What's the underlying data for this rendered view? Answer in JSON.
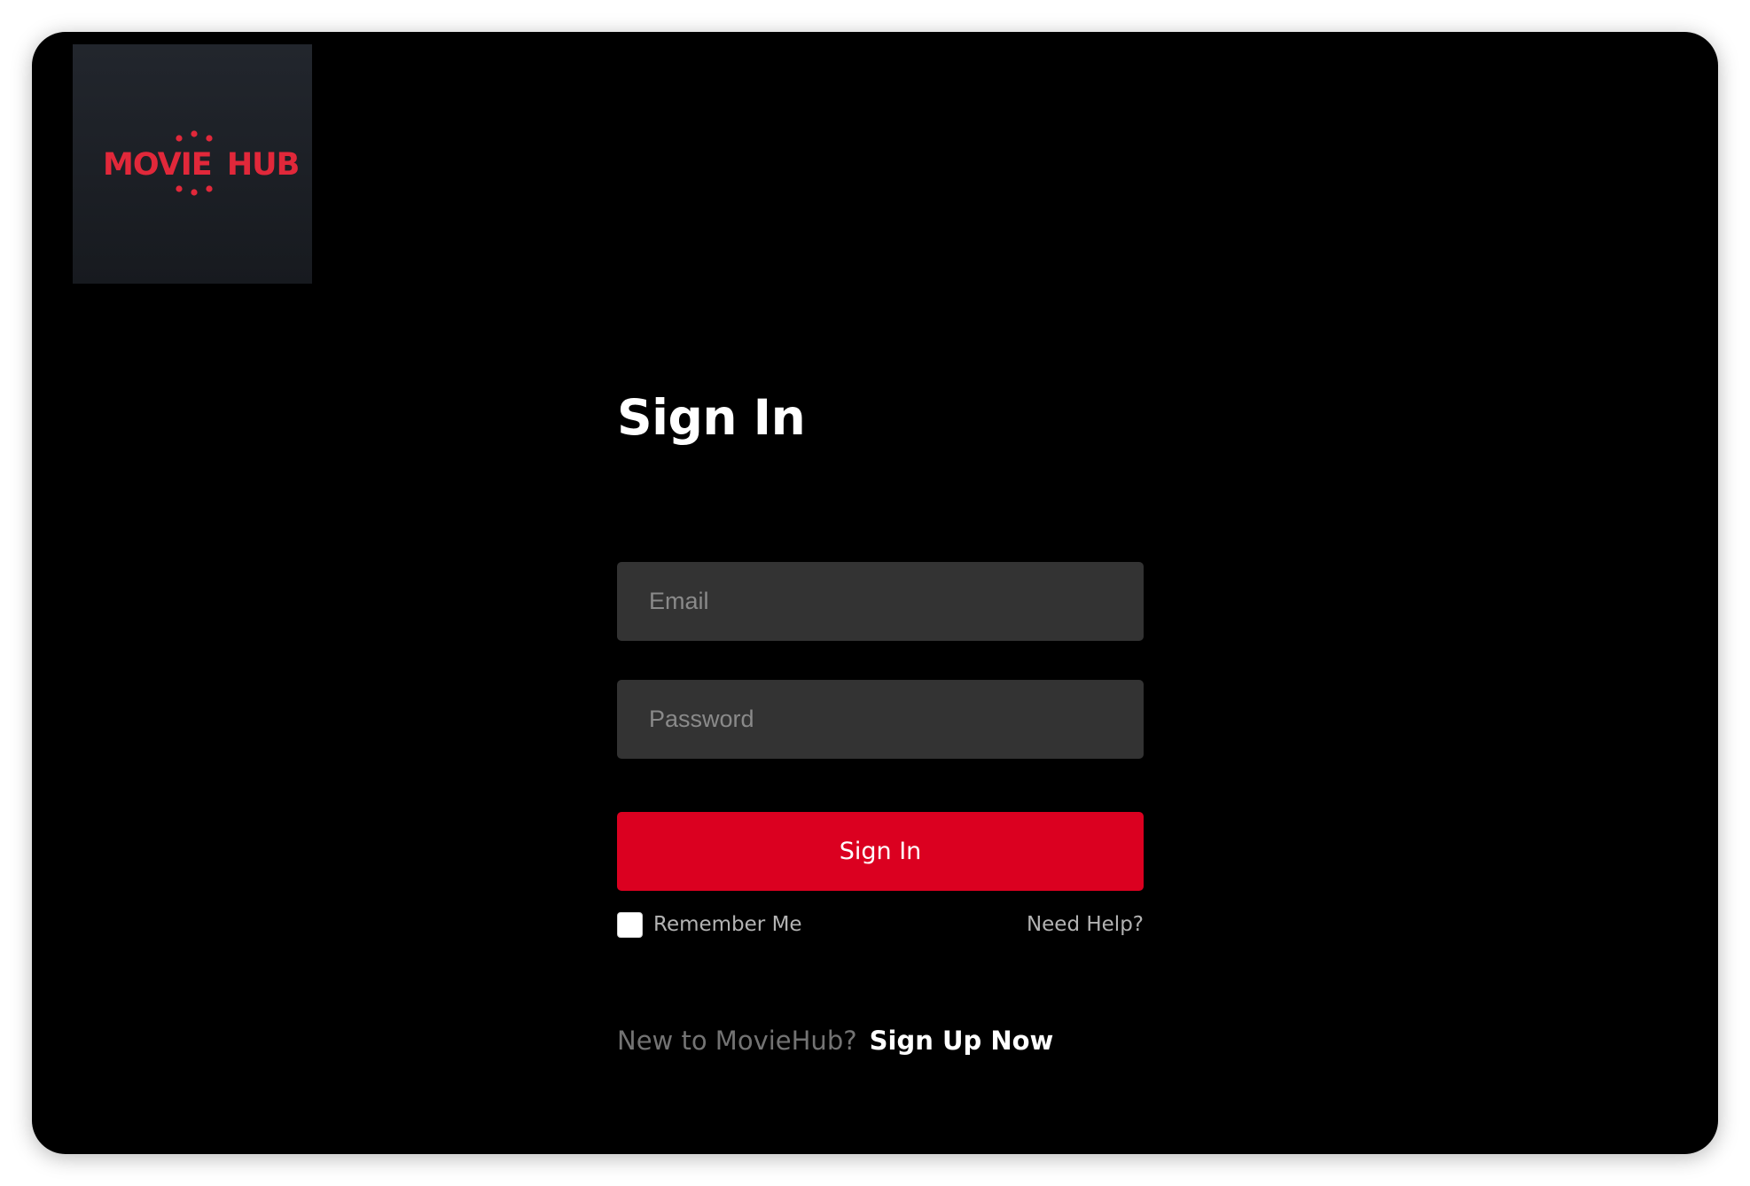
{
  "logo": {
    "text_left": "MOVIE",
    "text_right": "HUB",
    "accent_color": "#e1283a",
    "tile_color": "#1c2026"
  },
  "signin": {
    "title": "Sign In",
    "email_placeholder": "Email",
    "password_placeholder": "Password",
    "button_label": "Sign In",
    "remember_label": "Remember Me",
    "help_link": "Need Help?",
    "signup_prompt": "New to MovieHub?",
    "signup_link": "Sign Up Now"
  },
  "colors": {
    "background": "#000000",
    "input_background": "#333333",
    "button": "#db0020",
    "muted_text": "#b3b3b3"
  }
}
